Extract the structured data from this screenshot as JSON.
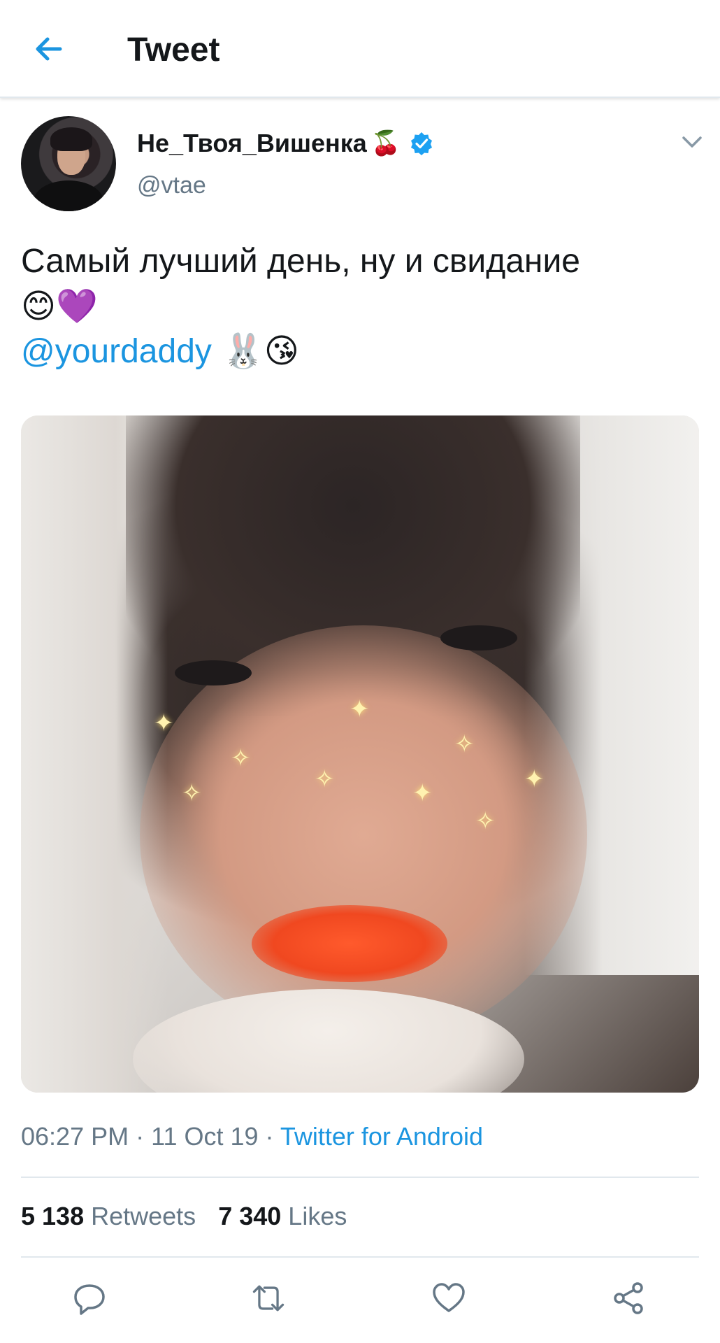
{
  "header": {
    "title": "Tweet",
    "back_icon": "arrow-left-icon",
    "accent_color": "#1b95e0"
  },
  "user": {
    "name": "Не_Твоя_Вишенка",
    "name_emoji": "🍒",
    "handle": "@vtae",
    "verified": true
  },
  "tweet": {
    "line1": "Самый лучший день, ну и свидание",
    "line2": "😊💜",
    "mention": "@yourdaddy",
    "mention_emoji": " 🐰😘"
  },
  "meta": {
    "time": "06:27 PM",
    "separator1": " · ",
    "date": "11 Oct 19",
    "separator2": " · ",
    "source": "Twitter for Android"
  },
  "stats": {
    "retweets_count": "5 138",
    "retweets_label": "Retweets",
    "likes_count": "7 340",
    "likes_label": "Likes"
  },
  "actions": {
    "reply_icon": "reply-icon",
    "retweet_icon": "retweet-icon",
    "like_icon": "heart-icon",
    "share_icon": "share-icon"
  }
}
